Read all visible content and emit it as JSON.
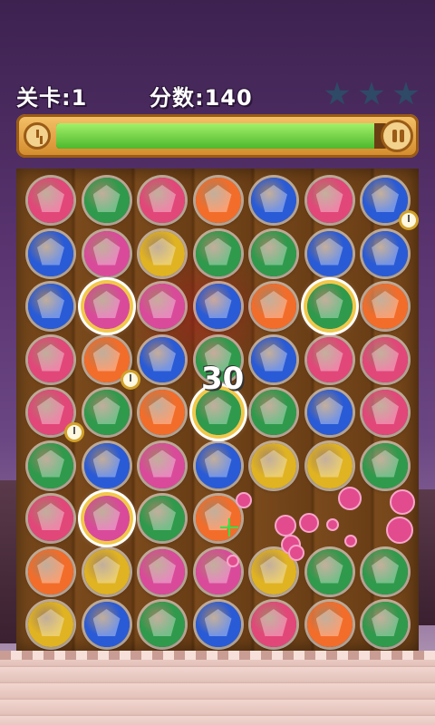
{
  "hud": {
    "level_text": "关卡:1",
    "score_text": "分数:140",
    "stars": {
      "earned": 0,
      "total": 3
    }
  },
  "timer": {
    "progress": 0.96
  },
  "board": {
    "rows": 9,
    "cols": 7,
    "colors": {
      "R": "#e2477a",
      "G": "#2f9a4c",
      "B": "#2a5bd6",
      "O": "#f36d2a",
      "Y": "#e0b322",
      "P": "#d94b9a"
    },
    "gems": [
      [
        "R",
        "G",
        "R",
        "O",
        "B",
        "R",
        "B"
      ],
      [
        "B",
        "P",
        "Y",
        "G",
        "G",
        "B",
        "B"
      ],
      [
        "B",
        "P",
        "P",
        "B",
        "O",
        "G",
        "O"
      ],
      [
        "R",
        "O",
        "B",
        "G",
        "B",
        "R",
        "R"
      ],
      [
        "R",
        "G",
        "O",
        "G",
        "G",
        "B",
        "R"
      ],
      [
        "G",
        "B",
        "P",
        "B",
        "Y",
        "Y",
        "G"
      ],
      [
        "R",
        "P",
        "G",
        "O",
        "",
        "",
        ""
      ],
      [
        "O",
        "Y",
        "P",
        "P",
        "Y",
        "G",
        "G"
      ],
      [
        "Y",
        "B",
        "G",
        "B",
        "R",
        "O",
        "G"
      ]
    ],
    "selected": [
      [
        2,
        1
      ],
      [
        2,
        5
      ],
      [
        4,
        3
      ],
      [
        6,
        1
      ]
    ],
    "clock_badges": [
      [
        0,
        6
      ],
      [
        3,
        1
      ],
      [
        4,
        0
      ]
    ]
  },
  "combo_text": "30",
  "icons": {
    "clock": "clock-icon",
    "pause": "pause-icon",
    "star": "star-icon"
  }
}
